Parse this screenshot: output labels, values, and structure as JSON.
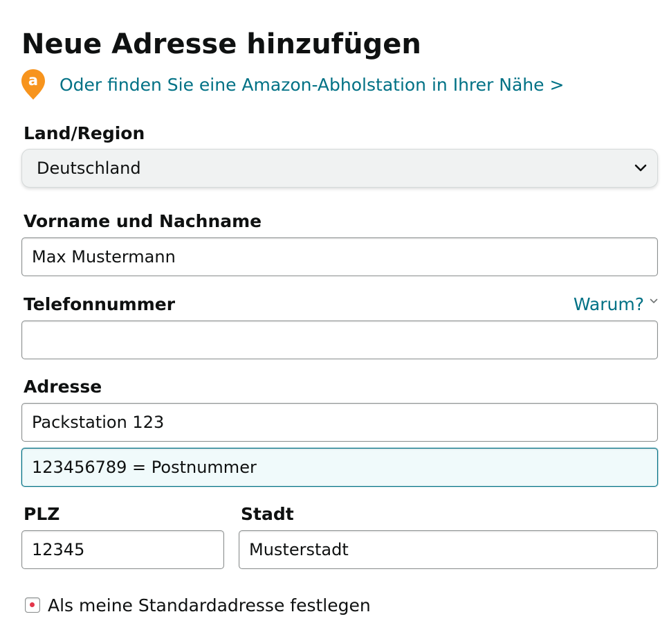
{
  "page": {
    "title": "Neue Adresse hinzufügen",
    "pickup_link": "Oder finden Sie eine Amazon-Abholstation in Ihrer Nähe >",
    "pickup_icon": "amazon-location-pin-icon",
    "pickup_icon_letter": "a"
  },
  "colors": {
    "link": "#007185",
    "pin": "#f7941d",
    "focus_border": "#007185",
    "focus_background": "#f0fafb"
  },
  "form": {
    "country": {
      "label": "Land/Region",
      "selected": "Deutschland"
    },
    "name": {
      "label": "Vorname und Nachname",
      "value": "Max Mustermann"
    },
    "phone": {
      "label": "Telefonnummer",
      "value": "",
      "help_link": "Warum?"
    },
    "address": {
      "label": "Adresse",
      "line1": "Packstation 123",
      "line2": "123456789 = Postnummer"
    },
    "zip": {
      "label": "PLZ",
      "value": "12345"
    },
    "city": {
      "label": "Stadt",
      "value": "Musterstadt"
    },
    "default_address": {
      "label": "Als meine Standardadresse festlegen"
    }
  }
}
